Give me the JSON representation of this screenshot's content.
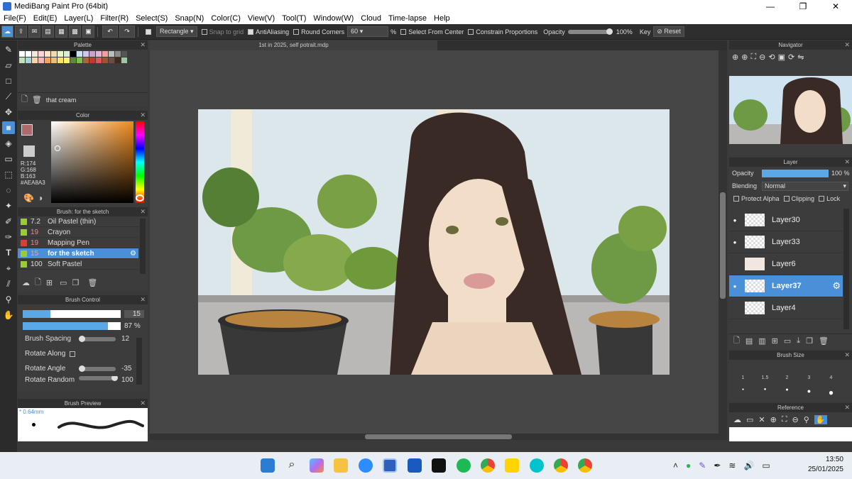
{
  "window": {
    "title": "MediBang Paint Pro (64bit)",
    "controls": [
      "—",
      "❐",
      "✕"
    ]
  },
  "menu": [
    "File(F)",
    "Edit(E)",
    "Layer(L)",
    "Filter(R)",
    "Select(S)",
    "Snap(N)",
    "Color(C)",
    "View(V)",
    "Tool(T)",
    "Window(W)",
    "Cloud",
    "Time-lapse",
    "Help"
  ],
  "toolbar": {
    "shape": "Rectangle",
    "snap_to_grid": "Snap to grid",
    "antialiasing": "AntiAliasing",
    "round_corners": "Round Corners",
    "round_value": "60",
    "percent": "%",
    "select_from_center": "Select From Center",
    "constrain_proportions": "Constrain Proportions",
    "opacity_label": "Opacity",
    "opacity_value": "100%",
    "key_label": "Key",
    "reset_label": "Reset"
  },
  "palette": {
    "title": "Palette",
    "item_name": "that cream",
    "colors": [
      "#ffffff",
      "#ffffff",
      "#f3e7d7",
      "#ffd1dc",
      "#ffe1c4",
      "#eedcb0",
      "#e7f5c8",
      "#d8eed8",
      "#000000",
      "#c7e3f5",
      "#d0c7ee",
      "#c8a2c8",
      "#e7b3d4",
      "#f0a0a0",
      "#bdbdbd",
      "#8a8a8a",
      "#555555",
      "#bfe3b4",
      "#a7d6d6",
      "#f6d6a6",
      "#f6b6b6",
      "#f4a460",
      "#e8c07d",
      "#ffe066",
      "#fff176",
      "#5c8a3a",
      "#7fbf4d",
      "#a7663f",
      "#c0392b",
      "#d65a5a",
      "#a0522d",
      "#6b4e3d",
      "#3f2a1e",
      "#9cc7a4"
    ]
  },
  "color": {
    "title": "Color",
    "r": "R:174",
    "g": "G:168",
    "b": "B:163",
    "hex": "#AEA8A3",
    "current": "#ae6a6a"
  },
  "brush": {
    "title": "Brush: for the sketch",
    "items": [
      {
        "size": "7.2",
        "name": "Oil Pastel (thin)",
        "color": "#9acd32"
      },
      {
        "size": "19",
        "name": "Crayon",
        "color": "#9acd32"
      },
      {
        "size": "19",
        "name": "Mapping Pen",
        "color": "#e53935"
      },
      {
        "size": "15",
        "name": "for the sketch",
        "color": "#9acd32"
      },
      {
        "size": "100",
        "name": "Soft Pastel",
        "color": "#9acd32"
      }
    ]
  },
  "brush_control": {
    "title": "Brush Control",
    "size_value": "15",
    "size_fraction": 0.28,
    "opacity_value": "87 %",
    "opacity_fraction": 0.87,
    "spacing_label": "Brush Spacing",
    "spacing_value": "12",
    "rotate_along_label": "Rotate Along",
    "rotate_angle_label": "Rotate Angle",
    "rotate_angle_value": "-35",
    "rotate_random_label": "Rotate Random",
    "rotate_random_value": "100"
  },
  "brush_preview": {
    "title": "Brush Preview",
    "size": "* 0.64mm"
  },
  "document": {
    "tab": "1st in 2025, self potrait.mdp"
  },
  "navigator": {
    "title": "Navigator"
  },
  "layer": {
    "title": "Layer",
    "opacity_label": "Opacity",
    "opacity_value": "100 %",
    "blending_label": "Blending",
    "blending_value": "Normal",
    "protect_alpha": "Protect Alpha",
    "clipping": "Clipping",
    "lock": "Lock",
    "layers": [
      "Layer30",
      "Layer33",
      "Layer6",
      "Layer37",
      "Layer4"
    ]
  },
  "brush_size": {
    "title": "Brush Size",
    "values": [
      "1",
      "1.5",
      "2",
      "3",
      "4"
    ]
  },
  "reference": {
    "title": "Reference"
  },
  "taskbar": {
    "time": "13:50",
    "date": "25/01/2025"
  }
}
